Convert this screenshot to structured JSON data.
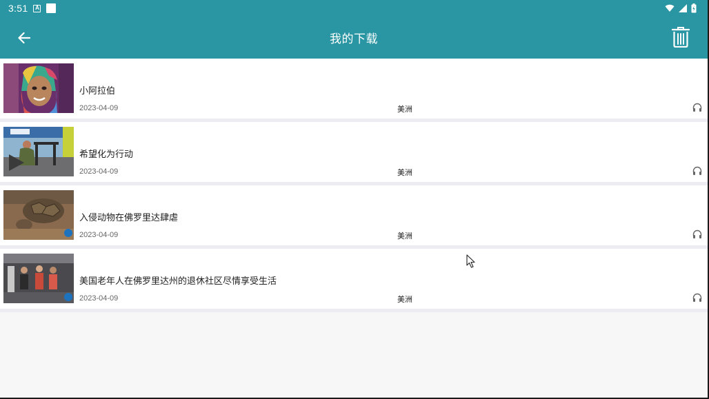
{
  "status_bar": {
    "time": "3:51",
    "icons": [
      "a-badge-icon",
      "square-notification-icon",
      "wifi-icon",
      "signal-icon",
      "battery-icon"
    ]
  },
  "app_bar": {
    "title": "我的下载",
    "back_icon": "arrow-left-icon",
    "delete_icon": "trash-icon",
    "color": "#2a96a3"
  },
  "downloads": [
    {
      "title": "小阿拉伯",
      "date": "2023-04-09",
      "region": "美洲",
      "icon": "headphones-icon"
    },
    {
      "title": "希望化为行动",
      "date": "2023-04-09",
      "region": "美洲",
      "icon": "headphones-icon"
    },
    {
      "title": "入侵动物在佛罗里达肆虐",
      "date": "2023-04-09",
      "region": "美洲",
      "icon": "headphones-icon"
    },
    {
      "title": "美国老年人在佛罗里达州的退休社区尽情享受生活",
      "date": "2023-04-09",
      "region": "美洲",
      "icon": "headphones-icon"
    }
  ]
}
